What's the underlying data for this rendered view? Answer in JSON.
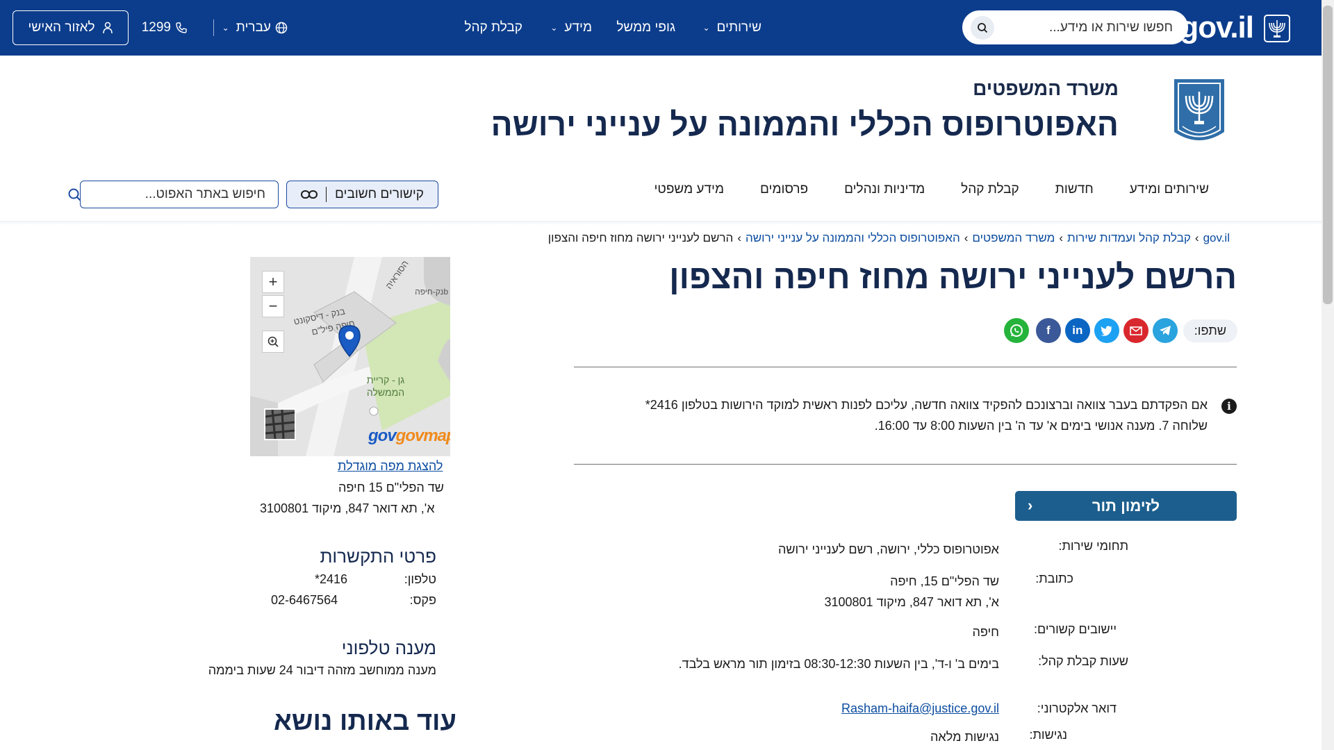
{
  "topbar": {
    "logo": "gov.il",
    "search_placeholder": "חפשו שירות או מידע...",
    "nav": [
      "שירותים",
      "גופי ממשל",
      "מידע",
      "קבלת קהל"
    ],
    "language": "עברית",
    "phone": "1299",
    "personal_area": "לאזור האישי"
  },
  "header": {
    "ministry": "משרד המשפטים",
    "title": "האפוטרופוס הכללי והממונה על ענייני ירושה",
    "nav": [
      "שירותים ומידע",
      "חדשות",
      "קבלת קהל",
      "מדיניות ונהלים",
      "פרסומים",
      "מידע משפטי"
    ],
    "links_button": "קישורים חשובים",
    "site_search_placeholder": "חיפוש באתר האפוט..."
  },
  "breadcrumb": [
    "gov.il",
    "קבלת קהל ועמדות שירות",
    "משרד המשפטים",
    "האפוטרופוס הכללי והממונה על ענייני ירושה",
    "הרשם לענייני ירושה מחוז חיפה והצפון"
  ],
  "page": {
    "title": "הרשם לענייני ירושה מחוז חיפה והצפון",
    "share_label": "שתפו:",
    "notice_line1": "אם הפקדתם בעבר צוואה וברצונכם להפקיד צוואה חדשה, עליכם לפנות ראשית למוקד הירושות בטלפון 2416*",
    "notice_line2": "שלוחה 7. מענה אנושי בימים א' עד ה' בין השעות 8:00 עד 16:00.",
    "appointment_button": "לזימון תור"
  },
  "details": {
    "service_areas_label": "תחומי שירות:",
    "service_areas_value": "אפוטרופוס כללי, ירושה, רשם לענייני ירושה",
    "address_label": "כתובת:",
    "address_line1": "שד הפלי\"ם 15, חיפה",
    "address_line2": "א', תא דואר 847, מיקוד 3100801",
    "settlements_label": "יישובים קשורים:",
    "settlements_value": "חיפה",
    "hours_label": "שעות קבלת קהל:",
    "hours_value": "בימים ב' ו-ד', בין השעות 08:30-12:30 בזימון תור מראש בלבד.",
    "email_label": "דואר אלקטרוני:",
    "email_value": "Rasham-haifa@justice.gov.il",
    "accessibility_label": "נגישות:",
    "accessibility_value": "נגישות מלאה"
  },
  "sidebar": {
    "map_labels": [
      "הסוראיה",
      "בנק - דיסקונט",
      "חיפה פיל\"ם",
      "גן - קריית הממשלה",
      "bנק-חיפה"
    ],
    "map_brand": "govmap",
    "map_link": "להצגת מפה מוגדלת",
    "address_line1": "שד הפלי\"ם 15 חיפה",
    "address_line2": "א', תא דואר 847, מיקוד 3100801",
    "contact_title": "פרטי התקשרות",
    "phone_label": "טלפון:",
    "phone_value": "2416*",
    "fax_label": "פקס:",
    "fax_value": "02-6467564",
    "phone_service_title": "מענה טלפוני",
    "phone_service_text": "מענה ממוחשב מזהה דיבור 24 שעות ביממה",
    "more_title": "עוד באותו נושא"
  },
  "colors": {
    "navy": "#0c3d8c",
    "title": "#15294f",
    "link": "#0b4ca0",
    "button": "#1c5f8e"
  }
}
